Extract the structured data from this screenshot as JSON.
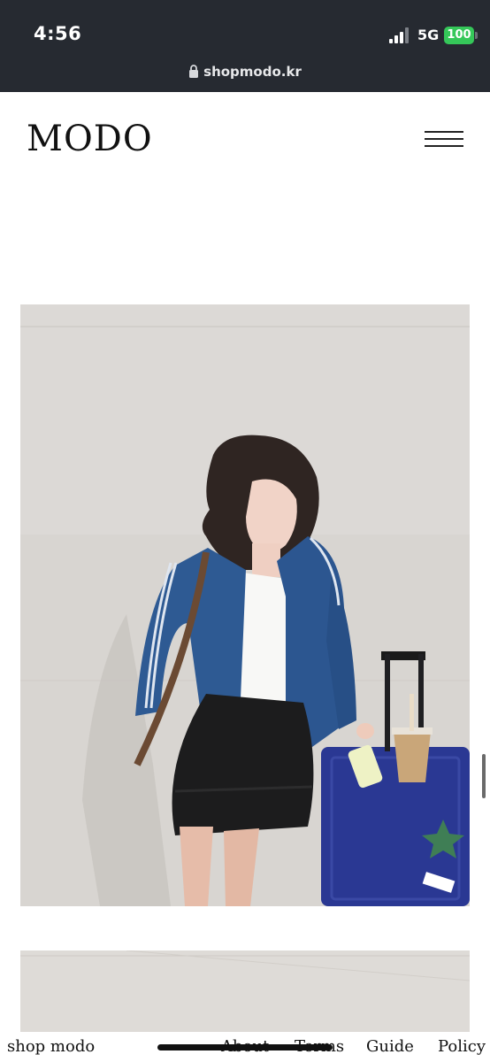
{
  "status_bar": {
    "time": "4:56",
    "network": "5G",
    "battery": "100",
    "battery_color": "#35c759"
  },
  "browser": {
    "url": "shopmodo.kr"
  },
  "header": {
    "logo": "MODO",
    "menu_icon": "hamburger-icon"
  },
  "product_images": [
    {
      "subject": "woman-in-blue-track-jacket-with-suitcase"
    },
    {
      "subject": "next-product-photo-partial"
    }
  ],
  "footer": {
    "brand": "shop modo",
    "links": [
      "About",
      "Terms",
      "Guide",
      "Policy"
    ]
  }
}
